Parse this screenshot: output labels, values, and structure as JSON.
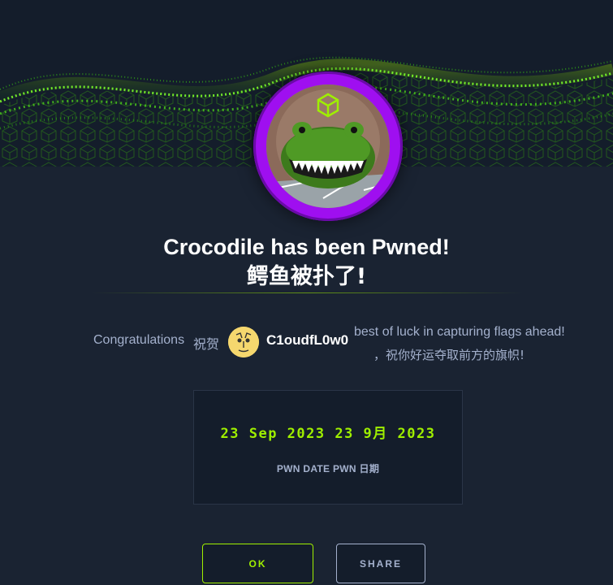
{
  "machine": {
    "title_en": "Crocodile has been Pwned!",
    "title_zh": "鳄鱼被扑了!"
  },
  "message": {
    "congrats": "Congratulations",
    "congrats_zh": "祝贺",
    "username": "C1oudfL0w0",
    "luck": "best of luck in capturing flags ahead!",
    "luck_zh": "，祝你好运夺取前方的旗帜!"
  },
  "pwn": {
    "date": "23 Sep 2023 23 9月 2023",
    "label": "PWN DATE PWN 日期"
  },
  "buttons": {
    "ok": "OK",
    "share": "SHARE"
  },
  "colors": {
    "accent": "#9fef00",
    "ring": "#9f0ff0",
    "background": "#1a2332",
    "muted": "#a4b1cd"
  },
  "icons": {
    "machine_avatar": "crocodile-avatar-icon",
    "user_avatar": "user-avatar-icon",
    "hack_logo": "cube-logo-icon"
  }
}
